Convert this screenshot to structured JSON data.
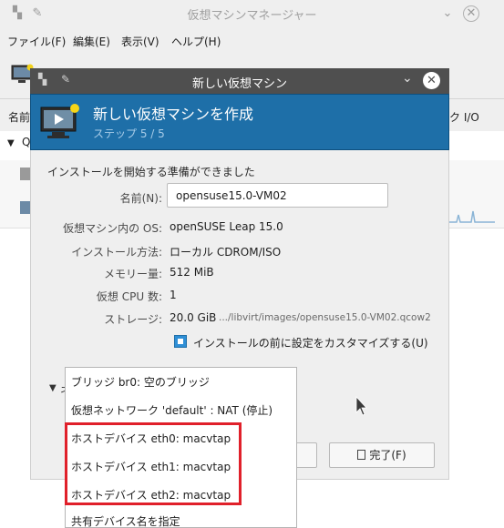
{
  "main_window": {
    "title": "仮想マシンマネージャー",
    "menu": [
      "ファイル(F)",
      "編集(E)",
      "表示(V)",
      "ヘルプ(H)"
    ],
    "col_name": "名前",
    "col_io": "ク I/O",
    "group_prefix": "Q"
  },
  "dialog": {
    "title": "新しい仮想マシン",
    "header_title": "新しい仮想マシンを作成",
    "step": "ステップ 5 / 5",
    "ready_text": "インストールを開始する準備ができました",
    "name_label": "名前(N):",
    "name_value": "opensuse15.0-VM02",
    "os_label": "仮想マシン内の OS:",
    "os_value": "openSUSE Leap 15.0",
    "install_label": "インストール方法:",
    "install_value": "ローカル CDROM/ISO",
    "memory_label": "メモリー量:",
    "memory_value": "512 MiB",
    "cpu_label": "仮想 CPU 数:",
    "cpu_value": "1",
    "storage_label": "ストレージ:",
    "storage_size": "20.0 GiB",
    "storage_path": ".../libvirt/images/opensuse15.0-VM02.qcow2",
    "customize_label": "インストールの前に設定をカスタマイズする(U)",
    "finish_label": "完了(F)"
  },
  "network_options": [
    "ブリッジ br0: 空のブリッジ",
    "仮想ネットワーク 'default' : NAT (停止)",
    "ホストデバイス eth0: macvtap",
    "ホストデバイス eth1: macvtap",
    "ホストデバイス eth2: macvtap",
    "共有デバイス名を指定"
  ],
  "colors": {
    "header_blue": "#1e6fa8",
    "highlight_red": "#e0202a",
    "check_blue": "#2f8fd6"
  }
}
